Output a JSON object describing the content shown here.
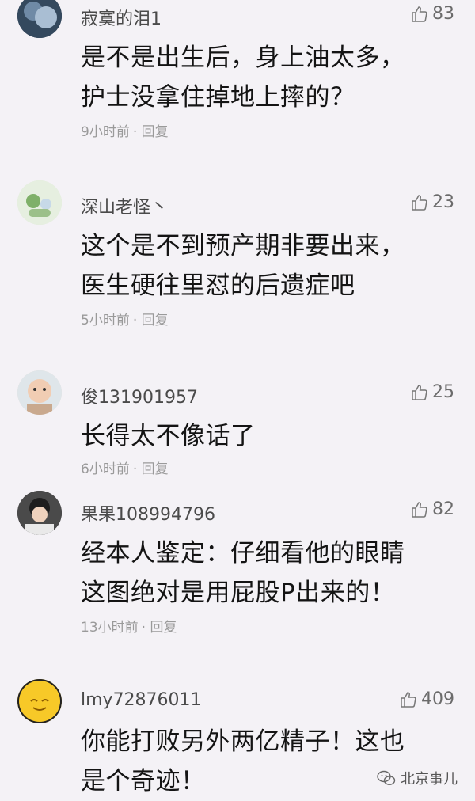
{
  "comments": [
    {
      "username": "寂寞的泪1",
      "likes": "83",
      "text": "是不是出生后，身上油太多，\n护士没拿住掉地上摔的？",
      "time": "9小时前",
      "reply": "· 回复",
      "avatar_icon": "dark-blue-abstract-avatar"
    },
    {
      "username": "深山老怪丶",
      "likes": "23",
      "text": "这个是不到预产期非要出来，\n医生硬往里怼的后遗症吧",
      "time": "5小时前",
      "reply": "· 回复",
      "avatar_icon": "green-cartoon-avatar"
    },
    {
      "username": "俊131901957",
      "likes": "25",
      "text": "长得太不像话了",
      "time": "6小时前",
      "reply": "· 回复",
      "avatar_icon": "baby-photo-avatar"
    },
    {
      "username": "果果108994796",
      "likes": "82",
      "text": "经本人鉴定：仔细看他的眼睛\n这图绝对是用屁股P出来的！",
      "time": "13小时前",
      "reply": "· 回复",
      "avatar_icon": "child-photo-avatar"
    },
    {
      "username": "lmy72876011",
      "likes": "409",
      "text": "你能打败另外两亿精子！这也\n是个奇迹！",
      "avatar_icon": "yellow-smiley-avatar"
    }
  ],
  "watermark": "北京事儿",
  "colors": {
    "background": "#f4f2f6",
    "text": "#141414",
    "meta": "#9a9a9a"
  }
}
